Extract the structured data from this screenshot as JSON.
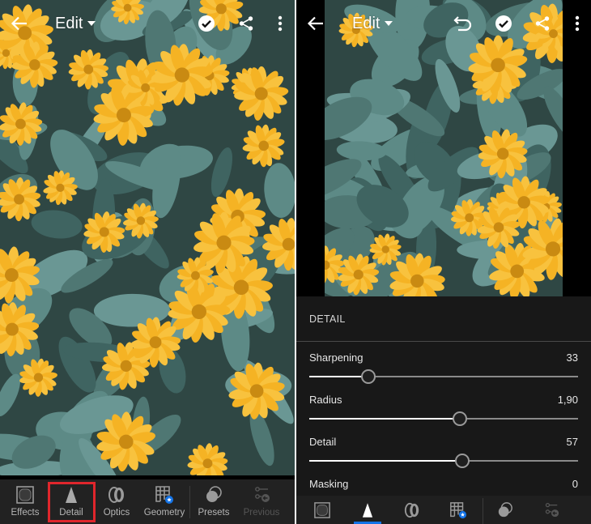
{
  "screens": [
    {
      "id": "left",
      "topbar": {
        "back_icon": "arrow-left-icon",
        "title": "Edit",
        "actions": [
          "checkmark-circle-icon",
          "share-icon",
          "more-vertical-icon"
        ]
      },
      "toolbar": {
        "active_tool": "Detail",
        "highlighted_tool": "Detail",
        "tools": [
          {
            "label": "Effects",
            "icon": "effects-vignette-icon",
            "enabled": true
          },
          {
            "label": "Detail",
            "icon": "detail-triangle-icon",
            "enabled": true
          },
          {
            "label": "Optics",
            "icon": "optics-lens-icon",
            "enabled": true
          },
          {
            "label": "Geometry",
            "icon": "geometry-grid-icon",
            "enabled": true
          },
          {
            "label": "Presets",
            "icon": "presets-circles-icon",
            "enabled": true
          },
          {
            "label": "Previous",
            "icon": "previous-sliders-icon",
            "enabled": false
          }
        ]
      }
    },
    {
      "id": "right",
      "topbar": {
        "back_icon": "arrow-left-icon",
        "title": "Edit",
        "actions": [
          "undo-icon",
          "checkmark-circle-icon",
          "share-icon",
          "more-vertical-icon"
        ]
      },
      "panel": {
        "title": "DETAIL",
        "sliders": [
          {
            "label": "Sharpening",
            "value": "33",
            "fraction": 0.22
          },
          {
            "label": "Radius",
            "value": "1,90",
            "fraction": 0.56
          },
          {
            "label": "Detail",
            "value": "57",
            "fraction": 0.57
          },
          {
            "label": "Masking",
            "value": "0",
            "fraction": 0.0
          }
        ]
      },
      "toolbar": {
        "active_tool": "Detail",
        "tools": [
          {
            "label": "Effects",
            "icon": "effects-vignette-icon",
            "enabled": true
          },
          {
            "label": "Detail",
            "icon": "detail-triangle-icon",
            "enabled": true
          },
          {
            "label": "Optics",
            "icon": "optics-lens-icon",
            "enabled": true
          },
          {
            "label": "Geometry",
            "icon": "geometry-grid-icon",
            "enabled": true
          },
          {
            "label": "Presets",
            "icon": "presets-circles-icon",
            "enabled": true
          },
          {
            "label": "Previous",
            "icon": "previous-sliders-icon",
            "enabled": false
          }
        ]
      }
    }
  ],
  "colors": {
    "accent": "#1473e6",
    "highlight_box": "#e0262c",
    "toolbar_bg": "#222222",
    "panel_bg": "#1a1a1a",
    "flower_yellow": "#f5b324",
    "leaf_teal": "#4f7773"
  }
}
